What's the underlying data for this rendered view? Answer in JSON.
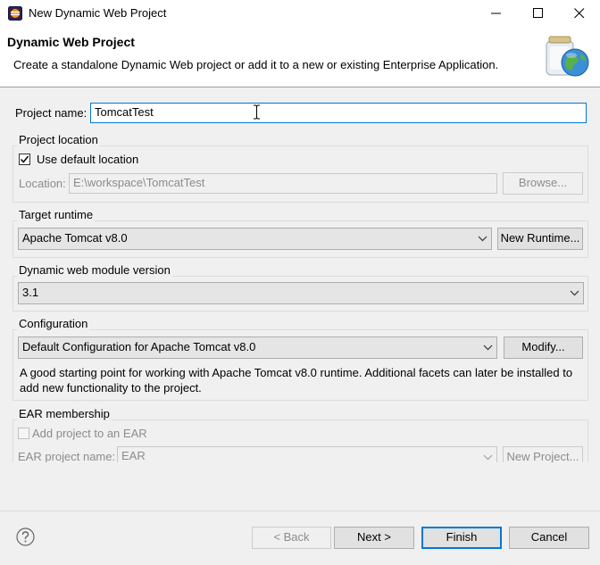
{
  "window": {
    "title": "New Dynamic Web Project"
  },
  "banner": {
    "title": "Dynamic Web Project",
    "description": "Create a standalone Dynamic Web project or add it to a new or existing Enterprise Application."
  },
  "project_name": {
    "label": "Project name:",
    "value": "TomcatTest"
  },
  "project_location": {
    "group_label": "Project location",
    "use_default_label": "Use default location",
    "use_default_checked": true,
    "location_label": "Location:",
    "location_value": "E:\\workspace\\TomcatTest",
    "browse_label": "Browse..."
  },
  "target_runtime": {
    "group_label": "Target runtime",
    "selected": "Apache Tomcat v8.0",
    "new_runtime_label": "New Runtime..."
  },
  "module_version": {
    "group_label": "Dynamic web module version",
    "selected": "3.1"
  },
  "configuration": {
    "group_label": "Configuration",
    "selected": "Default Configuration for Apache Tomcat v8.0",
    "modify_label": "Modify...",
    "description": "A good starting point for working with Apache Tomcat v8.0 runtime. Additional facets can later be installed to add new functionality to the project."
  },
  "ear": {
    "group_label": "EAR membership",
    "add_label": "Add project to an EAR",
    "add_checked": false,
    "name_label": "EAR project name:",
    "name_value": "EAR",
    "new_project_label": "New Project..."
  },
  "footer": {
    "back_label": "< Back",
    "next_label": "Next >",
    "finish_label": "Finish",
    "cancel_label": "Cancel"
  },
  "icons": [
    "eclipse-app-icon",
    "minimize-icon",
    "maximize-icon",
    "close-icon",
    "web-project-wizard-icon",
    "chevron-down-icon",
    "checkmark-icon",
    "help-icon",
    "text-cursor-icon"
  ],
  "colors": {
    "focus": "#0078d7",
    "background": "#f0f0f0"
  }
}
